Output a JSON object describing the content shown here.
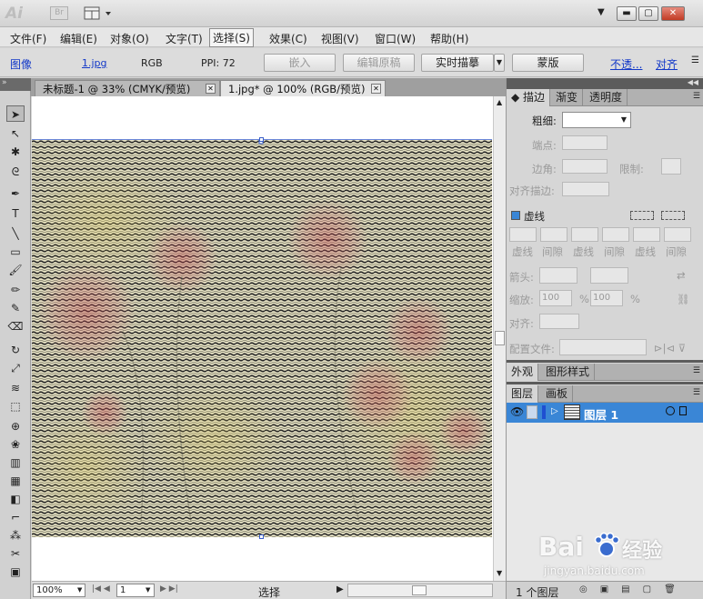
{
  "app": {
    "logo": "Ai",
    "bridge_label": "Br"
  },
  "menubar": {
    "items": [
      "文件(F)",
      "编辑(E)",
      "对象(O)",
      "文字(T)",
      "选择(S)",
      "效果(C)",
      "视图(V)",
      "窗口(W)",
      "帮助(H)"
    ],
    "active": "选择(S)"
  },
  "control_bar": {
    "kind": "图像",
    "file": "1.jpg",
    "color_mode": "RGB",
    "ppi": "PPI: 72",
    "embed_button": "嵌入",
    "edit_original_button": "编辑原稿",
    "live_trace_button": "实时描摹",
    "mask_button": "蒙版",
    "opacity_link": "不透...",
    "align_link": "对齐"
  },
  "tabs": [
    {
      "label": "未标题-1 @ 33% (CMYK/预览)",
      "active": false
    },
    {
      "label": "1.jpg* @ 100% (RGB/预览)",
      "active": true
    }
  ],
  "status": {
    "zoom": "100%",
    "artboard": "1",
    "tool": "选择"
  },
  "stroke_panel": {
    "tabs": [
      "描边",
      "渐变",
      "透明度"
    ],
    "weight_label": "粗细:",
    "cap_label": "端点:",
    "corner_label": "边角:",
    "limit_label": "限制:",
    "align_label": "对齐描边:",
    "dashed_label": "虚线",
    "dash_labels": [
      "虚线",
      "间隙",
      "虚线",
      "间隙",
      "虚线",
      "间隙"
    ],
    "arrow_label": "箭头:",
    "scale_label": "缩放:",
    "scale_values": [
      "100",
      "100"
    ],
    "percent": "%",
    "align2_label": "对齐:",
    "profile_label": "配置文件:"
  },
  "appearance_panel": {
    "tabs": [
      "外观",
      "图形样式"
    ]
  },
  "layers_panel": {
    "tabs": [
      "图层",
      "画板"
    ],
    "layer_name": "图层 1",
    "count": "1 个图层"
  },
  "watermark": {
    "brand": "Bai",
    "brand2": "经验",
    "url": "jingyan.baidu.com"
  }
}
